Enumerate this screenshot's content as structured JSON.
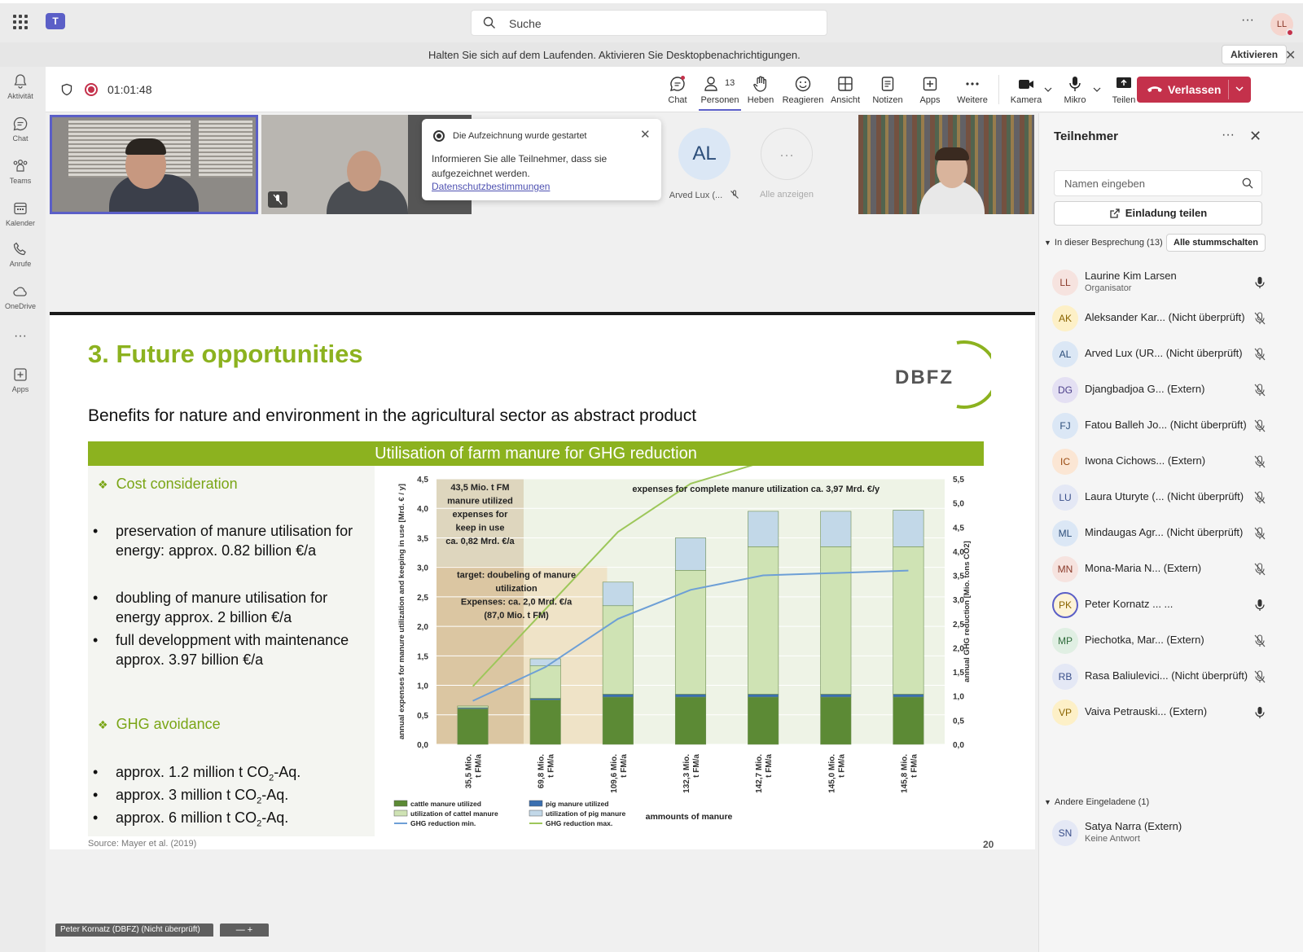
{
  "topbar": {
    "search_placeholder": "Suche",
    "more": "···",
    "user_initials": "LL"
  },
  "notification": {
    "message": "Halten Sie sich auf dem Laufenden. Aktivieren Sie Desktopbenachrichtigungen.",
    "button": "Aktivieren",
    "close": "✕"
  },
  "rail": [
    {
      "label": "Aktivität",
      "icon": "bell-icon"
    },
    {
      "label": "Chat",
      "icon": "chat-icon"
    },
    {
      "label": "Teams",
      "icon": "teams-icon"
    },
    {
      "label": "Kalender",
      "icon": "calendar-icon"
    },
    {
      "label": "Anrufe",
      "icon": "phone-icon"
    },
    {
      "label": "OneDrive",
      "icon": "cloud-icon"
    },
    {
      "label": "···",
      "icon": "more-icon"
    },
    {
      "label": "Apps",
      "icon": "apps-icon"
    }
  ],
  "meeting": {
    "timer": "01:01:48",
    "toolbar": {
      "chat": "Chat",
      "people": "Personen",
      "people_count": "13",
      "raise": "Heben",
      "react": "Reagieren",
      "view": "Ansicht",
      "notes": "Notizen",
      "apps": "Apps",
      "more": "Weitere",
      "camera": "Kamera",
      "mic": "Mikro",
      "share": "Teilen",
      "leave": "Verlassen"
    },
    "recording_popup": {
      "title": "Die Aufzeichnung wurde gestartet",
      "body": "Informieren Sie alle Teilnehmer, dass sie aufgezeichnet werden.",
      "link": "Datenschutzbestimmungen",
      "close": "✕"
    },
    "tiles": {
      "al_initials": "AL",
      "al_name": "Arved Lux (...",
      "show_all_glyph": "···",
      "show_all": "Alle anzeigen"
    },
    "name_tag": "Peter Kornatz (DBFZ) (Nicht überprüft)",
    "zoom_ctrl": "— +"
  },
  "slide": {
    "title": "3. Future opportunities",
    "logo": "DBFZ",
    "subtitle": "Benefits for nature and environment in the agricultural sector as abstract product",
    "banner": "Utilisation of farm manure for GHG reduction",
    "cost_heading": "Cost consideration",
    "cost_bullets": [
      "preservation of manure utilisation for energy: approx. 0.82 billion €/a",
      "doubling of manure utilisation for energy approx. 2 billion €/a",
      "full developpment with maintenance approx. 3.97 billion €/a"
    ],
    "ghg_heading": "GHG avoidance",
    "ghg_bullets": [
      {
        "pre": "approx. 1.2 million t CO",
        "sub": "2",
        "post": "-Aq."
      },
      {
        "pre": "approx. 3 million t CO",
        "sub": "2",
        "post": "-Aq."
      },
      {
        "pre": "approx. 6 million t CO",
        "sub": "2",
        "post": "-Aq."
      }
    ],
    "source": "Source: Mayer et al. (2019)",
    "page": "20"
  },
  "chart_data": {
    "type": "bar",
    "categories": [
      "35,5 Mio. t FM/a",
      "69,8 Mio. t FM/a",
      "109,6 Mio. t FM/a",
      "132,3 Mio. t FM/a",
      "142,7 Mio. t FM/a",
      "145,0 Mio. t FM/a",
      "145,8 Mio. t FM/a"
    ],
    "ylabel": "annual expenses for manure utilization and keeping in use [Mrd. € / y]",
    "y2label": "annual GHG reduction [Mio. tons CO2]",
    "xlabel": "ammounts of manure",
    "ylim": [
      0,
      4.5
    ],
    "y2lim": [
      0,
      5.5
    ],
    "yticks": [
      "0,0",
      "0,5",
      "1,0",
      "1,5",
      "2,0",
      "2,5",
      "3,0",
      "3,5",
      "4,0",
      "4,5"
    ],
    "y2ticks": [
      "0,0",
      "0,5",
      "1,0",
      "1,5",
      "2,0",
      "2,5",
      "3,0",
      "3,5",
      "4,0",
      "4,5",
      "5,0",
      "5,5"
    ],
    "series": [
      {
        "name": "cattle manure utilized",
        "color": "#5c8a35",
        "values": [
          0.6,
          0.75,
          0.8,
          0.8,
          0.8,
          0.8,
          0.8
        ]
      },
      {
        "name": "pig manure utilized",
        "color": "#3a6fb0",
        "values": [
          0.02,
          0.03,
          0.05,
          0.05,
          0.05,
          0.05,
          0.05
        ]
      },
      {
        "name": "utilization of cattel manure",
        "color": "#cfe3b4",
        "values": [
          0.03,
          0.55,
          1.5,
          2.1,
          2.5,
          2.5,
          2.5
        ]
      },
      {
        "name": "utilization of pig manure",
        "color": "#c2d8e8",
        "values": [
          0.0,
          0.12,
          0.4,
          0.55,
          0.6,
          0.6,
          0.62
        ]
      }
    ],
    "lines": [
      {
        "name": "GHG reduction min.",
        "color": "#6d9fd6",
        "values": [
          0.9,
          1.6,
          2.6,
          3.2,
          3.5,
          3.55,
          3.6
        ]
      },
      {
        "name": "GHG reduction max.",
        "color": "#9dc75a",
        "values": [
          1.2,
          2.8,
          4.4,
          5.4,
          5.85,
          5.95,
          6.0
        ]
      }
    ],
    "annotations": [
      {
        "text": [
          "43,5 Mio. t FM",
          "manure utilized",
          "expenses for",
          "keep in use",
          "ca. 0,82 Mrd. €/a"
        ]
      },
      {
        "text": [
          "target: doubeling of manure",
          "utilization",
          "Expenses: ca. 2,0 Mrd. €/a",
          "(87,0 Mio. t FM)"
        ]
      },
      {
        "text": [
          "expenses for complete manure utilization ca. 3,97 Mrd. €/y"
        ]
      }
    ]
  },
  "panel": {
    "title": "Teilnehmer",
    "more": "···",
    "close": "✕",
    "search_placeholder": "Namen eingeben",
    "invite": "Einladung teilen",
    "in_meeting": "In dieser Besprechung (13)",
    "mute_all": "Alle stummschalten",
    "others": "Andere Eingeladene (1)",
    "participants": [
      {
        "initials": "LL",
        "name": "Laurine Kim Larsen",
        "sub": "Organisator",
        "bg": "#f6e3df",
        "fg": "#8a3a2a",
        "mic": "on"
      },
      {
        "initials": "AK",
        "name": "Aleksander Kar... (Nicht überprüft)",
        "sub": "",
        "bg": "#fdf0c7",
        "fg": "#8a6400",
        "mic": "off"
      },
      {
        "initials": "AL",
        "name": "Arved Lux (UR...   (Nicht überprüft)",
        "sub": "",
        "bg": "#dbe7f5",
        "fg": "#2c4e7a",
        "mic": "off"
      },
      {
        "initials": "DG",
        "name": "Djangbadjoa G... (Extern)",
        "sub": "",
        "bg": "#e4e0f3",
        "fg": "#4c3f8a",
        "mic": "off"
      },
      {
        "initials": "FJ",
        "name": "Fatou Balleh Jo... (Nicht überprüft)",
        "sub": "",
        "bg": "#dbe7f5",
        "fg": "#2c4e7a",
        "mic": "off"
      },
      {
        "initials": "IC",
        "name": "Iwona Cichows... (Extern)",
        "sub": "",
        "bg": "#fbe6d4",
        "fg": "#9a4a10",
        "mic": "off"
      },
      {
        "initials": "LU",
        "name": "Laura Uturyte (... (Nicht überprüft)",
        "sub": "",
        "bg": "#e4e8f5",
        "fg": "#3a4f8a",
        "mic": "off"
      },
      {
        "initials": "ML",
        "name": "Mindaugas Agr... (Nicht überprüft)",
        "sub": "",
        "bg": "#dbe7f5",
        "fg": "#2c4e7a",
        "mic": "off"
      },
      {
        "initials": "MN",
        "name": "Mona-Maria N... (Extern)",
        "sub": "",
        "bg": "#f6e3df",
        "fg": "#8a3a2a",
        "mic": "off"
      },
      {
        "initials": "PK",
        "name": "Peter Kornatz ...   ...",
        "sub": "",
        "bg": "#fdf3d8",
        "fg": "#8a6400",
        "mic": "on",
        "ring": true
      },
      {
        "initials": "MP",
        "name": "Piechotka, Mar... (Extern)",
        "sub": "",
        "bg": "#e0efe3",
        "fg": "#2d6b3a",
        "mic": "off"
      },
      {
        "initials": "RB",
        "name": "Rasa Baliulevici... (Nicht überprüft)",
        "sub": "",
        "bg": "#e4e8f5",
        "fg": "#3a4f8a",
        "mic": "off"
      },
      {
        "initials": "VP",
        "name": "Vaiva Petrauski... (Extern)",
        "sub": "",
        "bg": "#fdf0c7",
        "fg": "#8a6400",
        "mic": "on"
      }
    ],
    "other_invitee": {
      "initials": "SN",
      "name": "Satya Narra (Extern)",
      "sub": "Keine Antwort",
      "bg": "#e4e8f5",
      "fg": "#3a4f8a"
    }
  }
}
